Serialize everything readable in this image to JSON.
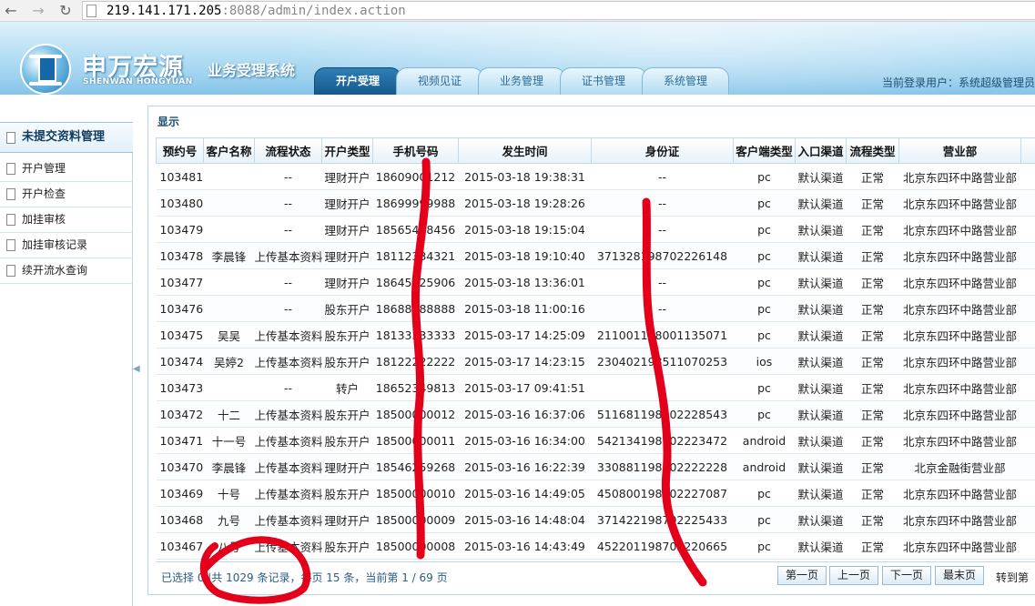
{
  "browser": {
    "url_host": "219.141.171.205",
    "url_path": ":8088/admin/index.action"
  },
  "header": {
    "brand_cn": "申万宏源",
    "brand_en": "SHENWAN HONGYUAN",
    "system_name": "业务受理系统",
    "tabs": [
      "开户受理",
      "视频见证",
      "业务管理",
      "证书管理",
      "系统管理"
    ],
    "active_tab": "开户受理",
    "current_user": "当前登录用户：系统超级管理员"
  },
  "sidebar": {
    "heading": "未提交资料管理",
    "items": [
      "开户管理",
      "开户检查",
      "加挂审核",
      "加挂审核记录",
      "续开流水查询"
    ]
  },
  "panel": {
    "title": "显示",
    "columns": [
      "预约号",
      "客户名称",
      "流程状态",
      "开户类型",
      "手机号码",
      "发生时间",
      "身份证",
      "客户端类型",
      "入口渠道",
      "流程类型",
      "营业部"
    ],
    "rows": [
      [
        "103481",
        "",
        "--",
        "理财开户",
        "18609001212",
        "2015-03-18 19:38:31",
        "--",
        "pc",
        "默认渠道",
        "正常",
        "北京东四环中路营业部"
      ],
      [
        "103480",
        "",
        "--",
        "理财开户",
        "18699999988",
        "2015-03-18 19:28:26",
        "--",
        "pc",
        "默认渠道",
        "正常",
        "北京东四环中路营业部"
      ],
      [
        "103479",
        "",
        "--",
        "理财开户",
        "18565438456",
        "2015-03-18 19:15:04",
        "--",
        "pc",
        "默认渠道",
        "正常",
        "北京东四环中路营业部"
      ],
      [
        "103478",
        "李晨锋",
        "上传基本资料",
        "理财开户",
        "18112334321",
        "2015-03-18 19:10:40",
        "371328198702226148",
        "pc",
        "默认渠道",
        "正常",
        "北京东四环中路营业部"
      ],
      [
        "103477",
        "",
        "--",
        "理财开户",
        "18645325906",
        "2015-03-18 13:36:01",
        "--",
        "pc",
        "默认渠道",
        "正常",
        "北京东四环中路营业部"
      ],
      [
        "103476",
        "",
        "--",
        "股东开户",
        "18688888888",
        "2015-03-18 11:00:16",
        "--",
        "pc",
        "默认渠道",
        "正常",
        "北京东四环中路营业部"
      ],
      [
        "103475",
        "吴吴",
        "上传基本资料",
        "股东开户",
        "18133333333",
        "2015-03-17 14:25:09",
        "211001198001135071",
        "pc",
        "默认渠道",
        "正常",
        "北京东四环中路营业部"
      ],
      [
        "103474",
        "吴婷2",
        "上传基本资料",
        "股东开户",
        "18122222222",
        "2015-03-17 14:23:15",
        "230402198511070253",
        "ios",
        "默认渠道",
        "正常",
        "北京东四环中路营业部"
      ],
      [
        "103473",
        "",
        "--",
        "转户",
        "18652349813",
        "2015-03-17 09:41:51",
        "",
        "pc",
        "默认渠道",
        "正常",
        "北京东四环中路营业部"
      ],
      [
        "103472",
        "十二",
        "上传基本资料",
        "股东开户",
        "18500000012",
        "2015-03-16 16:37:06",
        "511681198702228543",
        "pc",
        "默认渠道",
        "正常",
        "北京东四环中路营业部"
      ],
      [
        "103471",
        "十一号",
        "上传基本资料",
        "股东开户",
        "18500000011",
        "2015-03-16 16:34:00",
        "542134198702223472",
        "android",
        "默认渠道",
        "正常",
        "北京东四环中路营业部"
      ],
      [
        "103470",
        "李晨锋",
        "上传基本资料",
        "理财开户",
        "18546259268",
        "2015-03-16 16:22:39",
        "330881198702222228",
        "android",
        "默认渠道",
        "正常",
        "北京金融街营业部"
      ],
      [
        "103469",
        "十号",
        "上传基本资料",
        "股东开户",
        "18500000010",
        "2015-03-16 14:49:05",
        "450800198702227087",
        "pc",
        "默认渠道",
        "正常",
        "北京东四环中路营业部"
      ],
      [
        "103468",
        "九号",
        "上传基本资料",
        "理财开户",
        "18500000009",
        "2015-03-16 14:48:04",
        "371422198702225433",
        "pc",
        "默认渠道",
        "正常",
        "北京东四环中路营业部"
      ],
      [
        "103467",
        "八号",
        "上传基本资料",
        "股东开户",
        "18500000008",
        "2015-03-16 14:43:49",
        "452201198702220665",
        "pc",
        "默认渠道",
        "正常",
        "北京东四环中路营业部"
      ]
    ]
  },
  "pager": {
    "info": "已选择 0 |共 1029 条记录，每页 15 条，当前第 1 / 69 页",
    "first": "第一页",
    "prev": "上一页",
    "next": "下一页",
    "last": "最末页",
    "goto": "转到第"
  },
  "colors": {
    "header_blue": "#86c4e8",
    "active_tab": "#15588c",
    "annotation_red": "#e4001a"
  }
}
